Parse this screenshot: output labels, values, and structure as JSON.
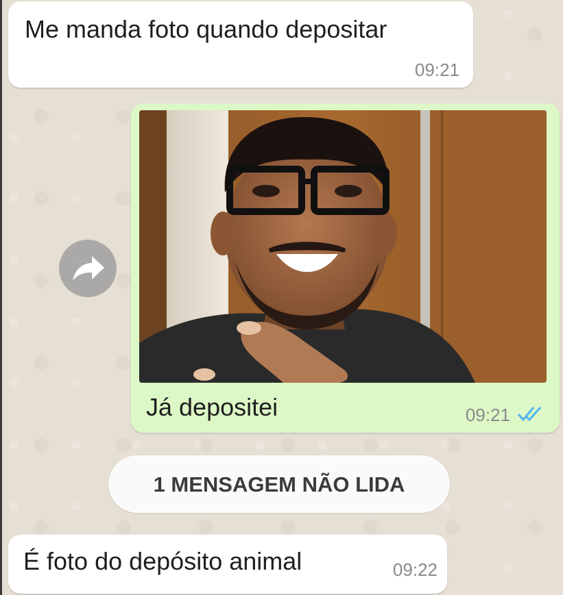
{
  "messages": [
    {
      "direction": "incoming",
      "text": "Me manda foto quando depositar",
      "time": "09:21"
    },
    {
      "direction": "outgoing",
      "caption": "Já depositei",
      "time": "09:21",
      "status": "read-double-check-icon",
      "has_photo": true
    },
    {
      "direction": "incoming",
      "text": "É foto do depósito animal",
      "time": "09:22"
    }
  ],
  "unread_banner": "1 MENSAGEM NÃO LIDA",
  "colors": {
    "chat_background": "#e6dfd4",
    "incoming_bubble": "#ffffff",
    "outgoing_bubble": "#dcf8c6",
    "read_ticks": "#4fb6ec",
    "timestamp": "#8a8a8a"
  },
  "icons": {
    "forward": "forward-arrow-icon",
    "status": "double-check-icon"
  }
}
